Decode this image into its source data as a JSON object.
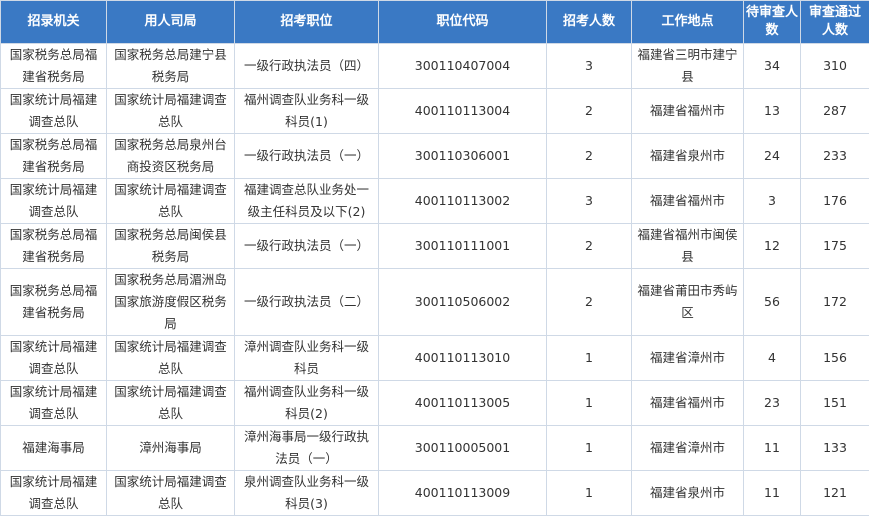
{
  "headers": [
    "招录机关",
    "用人司局",
    "招考职位",
    "职位代码",
    "招考人数",
    "工作地点",
    "待审查人数",
    "审查通过人数"
  ],
  "rows": [
    [
      "国家税务总局福建省税务局",
      "国家税务总局建宁县税务局",
      "一级行政执法员（四）",
      "300110407004",
      "3",
      "福建省三明市建宁县",
      "34",
      "310"
    ],
    [
      "国家统计局福建调查总队",
      "国家统计局福建调查总队",
      "福州调查队业务科一级科员(1)",
      "400110113004",
      "2",
      "福建省福州市",
      "13",
      "287"
    ],
    [
      "国家税务总局福建省税务局",
      "国家税务总局泉州台商投资区税务局",
      "一级行政执法员（一）",
      "300110306001",
      "2",
      "福建省泉州市",
      "24",
      "233"
    ],
    [
      "国家统计局福建调查总队",
      "国家统计局福建调查总队",
      "福建调查总队业务处一级主任科员及以下(2)",
      "400110113002",
      "3",
      "福建省福州市",
      "3",
      "176"
    ],
    [
      "国家税务总局福建省税务局",
      "国家税务总局闽侯县税务局",
      "一级行政执法员（一）",
      "300110111001",
      "2",
      "福建省福州市闽侯县",
      "12",
      "175"
    ],
    [
      "国家税务总局福建省税务局",
      "国家税务总局湄洲岛国家旅游度假区税务局",
      "一级行政执法员（二）",
      "300110506002",
      "2",
      "福建省莆田市秀屿区",
      "56",
      "172"
    ],
    [
      "国家统计局福建调查总队",
      "国家统计局福建调查总队",
      "漳州调查队业务科一级科员",
      "400110113010",
      "1",
      "福建省漳州市",
      "4",
      "156"
    ],
    [
      "国家统计局福建调查总队",
      "国家统计局福建调查总队",
      "福州调查队业务科一级科员(2)",
      "400110113005",
      "1",
      "福建省福州市",
      "23",
      "151"
    ],
    [
      "福建海事局",
      "漳州海事局",
      "漳州海事局一级行政执法员（一）",
      "300110005001",
      "1",
      "福建省漳州市",
      "11",
      "133"
    ],
    [
      "国家统计局福建调查总队",
      "国家统计局福建调查总队",
      "泉州调查队业务科一级科员(3)",
      "400110113009",
      "1",
      "福建省泉州市",
      "11",
      "121"
    ]
  ]
}
